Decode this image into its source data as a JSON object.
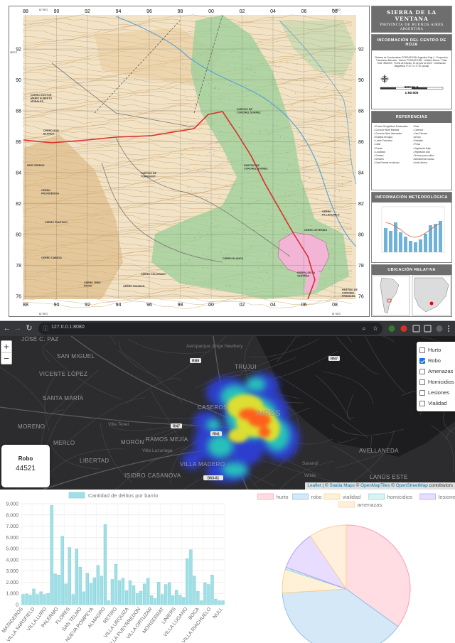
{
  "sheet": {
    "title": "SIERRA DE LA VENTANA",
    "subtitle": "PROVINCIA DE BUENOS AIRES",
    "country": "ARGENTINA",
    "info_header": "INFORMACIÓN DEL CENTRO DE HOJA",
    "info_text": "Sistema de Coordenadas: POSGAR 1994 Argentina Faja 4 · Proyección: Transversa Mercator · Datum: POSGAR 1994 · Unidad: Metros · Falso Este: 4500000 · Fecha de Edición: 13 de julio de 2023 · Declinación Magnética: 5°12' O ± 0°10' (anual)",
    "scale_label": "ESCALA",
    "scale_value": "1:50.000",
    "references_header": "REFERENCIAS",
    "references": [
      "Puntos Geográficos Destacados",
      "Ruta",
      "Curva de Nivel Maestra",
      "Caminos",
      "Curva de Nivel Intermedia",
      "Vías Férreas",
      "Espejos de Agua",
      "Arroyo",
      "Límite Provincial",
      "Embalse",
      "Calle",
      "Presa",
      "Puente",
      "Vegetación Baja",
      "Localidad",
      "Vegetación Alta",
      "Cantera",
      "Terreno para cultivo",
      "Sendero",
      "Afloramiento rocoso",
      "Vías Férreas en desuso",
      "Área Urbana"
    ],
    "meteo_header": "INFORMACIÓN METEOROLÓGICA",
    "location_header": "UBICACIÓN RELATIVA",
    "grid_top": [
      "88",
      "90",
      "92",
      "94",
      "96",
      "98",
      "00",
      "02",
      "04",
      "06",
      "08"
    ],
    "grid_side": [
      "92",
      "90",
      "88",
      "86",
      "84",
      "82",
      "80",
      "78",
      "76"
    ],
    "corner_coords": [
      "61°55'O",
      "61°45'O",
      "61°55'O",
      "61°45'O",
      "38°5'S"
    ],
    "place_labels": [
      "CERRO DOCTOR MARIO ALBERTO MORALES",
      "CERRO SAN BLANCO",
      "SEIS CERROS",
      "CERRO PROVIDENCIA",
      "CERRO PUNTUDO",
      "CERRO CABEZA",
      "CERRO TRES PICOS",
      "CERRO COLORADO",
      "CERRO HICASCH",
      "PARTIDO DE TORNQUIST",
      "PARTIDO DE CORONEL SUÁREZ",
      "PARTIDO DE CORONEL SUÁREZ",
      "CERRO BLANCO",
      "CERRO ZEFERINO",
      "CERRO PILLAHUINCO",
      "PARTIDO DE CORONEL PRINGLES",
      "SIERRA DE LA VENTANA"
    ]
  },
  "browser": {
    "url": "127.0.0.1:8080",
    "icons": [
      "back-arrow-icon",
      "forward-arrow-icon",
      "reload-icon",
      "info-icon",
      "zoom-icon",
      "star-icon",
      "extension-icon",
      "menu-icon"
    ]
  },
  "leaflet": {
    "zoom_in": "+",
    "zoom_out": "−",
    "layers": [
      {
        "label": "Hurto",
        "checked": false
      },
      {
        "label": "Robo",
        "checked": true
      },
      {
        "label": "Amenazas",
        "checked": false
      },
      {
        "label": "Homicidios",
        "checked": false
      },
      {
        "label": "Lesiones",
        "checked": false
      },
      {
        "label": "Vialidad",
        "checked": false
      }
    ],
    "info_title": "Robo",
    "info_value": "44521",
    "place_labels": [
      "JOSÉ C. PAZ",
      "SAN MIGUEL",
      "VICENTE LÓPEZ",
      "SANTA MARÍA",
      "Aeroparque Jorge Newbery",
      "TRUJUI",
      "CASEROS",
      "AIRES",
      "MORENO",
      "Villa Tesei",
      "RAMOS MEJÍA",
      "MERLO",
      "MORÓN",
      "Villa Luzuriaga",
      "AVELLANEDA",
      "LIBERTAD",
      "VILLA MADERO",
      "Sarandí",
      "ISIDRO CASANOVA",
      "LANÚS ESTE",
      "Wilde"
    ],
    "road_shields": [
      "RN9",
      "RN7",
      "RN1",
      "RN7",
      "D63-01"
    ],
    "attribution": {
      "leaflet": "Leaflet",
      "sep1": " | © ",
      "stadia": "Stadia Maps",
      "sep2": " © ",
      "omt": "OpenMapTiles",
      "sep3": " © ",
      "osm": "OpenStreetMap",
      "tail": " contributors"
    }
  },
  "chart_data": [
    {
      "type": "bar",
      "title": "",
      "legend": "Cantidad de delitos por barrio",
      "ylim": [
        0,
        9000
      ],
      "yticks": [
        "0",
        "1.000",
        "2.000",
        "3.000",
        "4.000",
        "5.000",
        "6.000",
        "7.000",
        "8.000",
        "9.000"
      ],
      "tick_labels": [
        "MATADEROS",
        "VILLA SARSFIELD",
        "VILLA LURO",
        "PALERMO",
        "FLORES",
        "SAN TELMO",
        "NUEVA POMPEYA",
        "ALMAGRO",
        "RETIRO",
        "VILLA URQUIZA",
        "VILLA PUEYRREDON",
        "VILLA ORTUZAR",
        "MONSERRAT",
        "LINIERS",
        "VILLA LUGANO",
        "BOCA",
        "VILLA RIACHUELO",
        "NULL"
      ],
      "values": [
        900,
        950,
        850,
        1400,
        900,
        1150,
        900,
        1000,
        8850,
        2750,
        2650,
        6100,
        1850,
        5100,
        900,
        4950,
        3350,
        1150,
        2800,
        1900,
        2400,
        3500,
        2550,
        7150,
        350,
        2250,
        3600,
        2150,
        2350,
        1250,
        2150,
        1700,
        1000,
        1200,
        1850,
        2350,
        800,
        550,
        2000,
        900,
        1800,
        1950,
        800,
        1300,
        850,
        650,
        4100,
        4900,
        2550,
        1200,
        350,
        1950,
        1800,
        2650,
        500,
        350,
        350
      ],
      "color": "#9fe0e6",
      "grid": true
    },
    {
      "type": "pie",
      "title": "",
      "legend": [
        "hurto",
        "robo",
        "vialidad",
        "homicidios",
        "lesiones",
        "amenazas"
      ],
      "values": [
        35,
        39,
        6,
        0.5,
        10,
        9.5
      ],
      "colors": [
        "#ffdde3",
        "#d4e8f8",
        "#fff1d8",
        "#d9f2f2",
        "#e8ddff",
        "#fff0dd"
      ],
      "borders": [
        "#ff9db0",
        "#8fc1ea",
        "#ffd08a",
        "#8fd7d7",
        "#b69cff",
        "#ffcf99"
      ]
    }
  ]
}
